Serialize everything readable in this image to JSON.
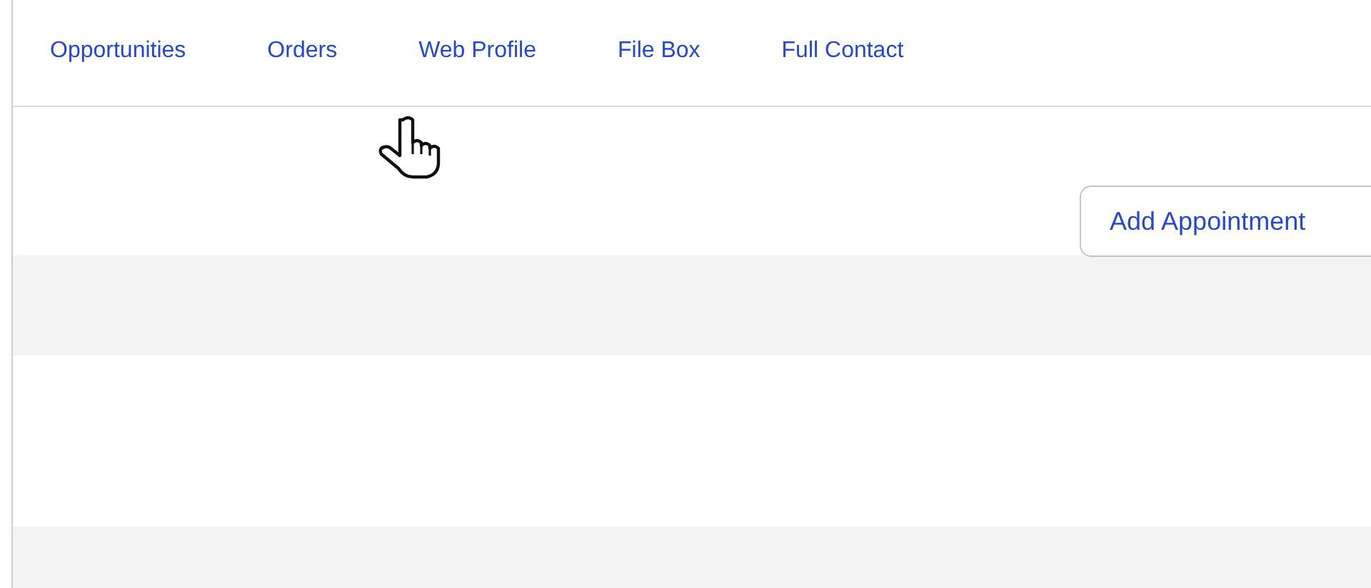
{
  "tabs": [
    {
      "label": "Opportunities"
    },
    {
      "label": "Orders"
    },
    {
      "label": "Web Profile"
    },
    {
      "label": "File Box"
    },
    {
      "label": "Full Contact"
    }
  ],
  "add_button": {
    "label": "Add Appointment"
  }
}
